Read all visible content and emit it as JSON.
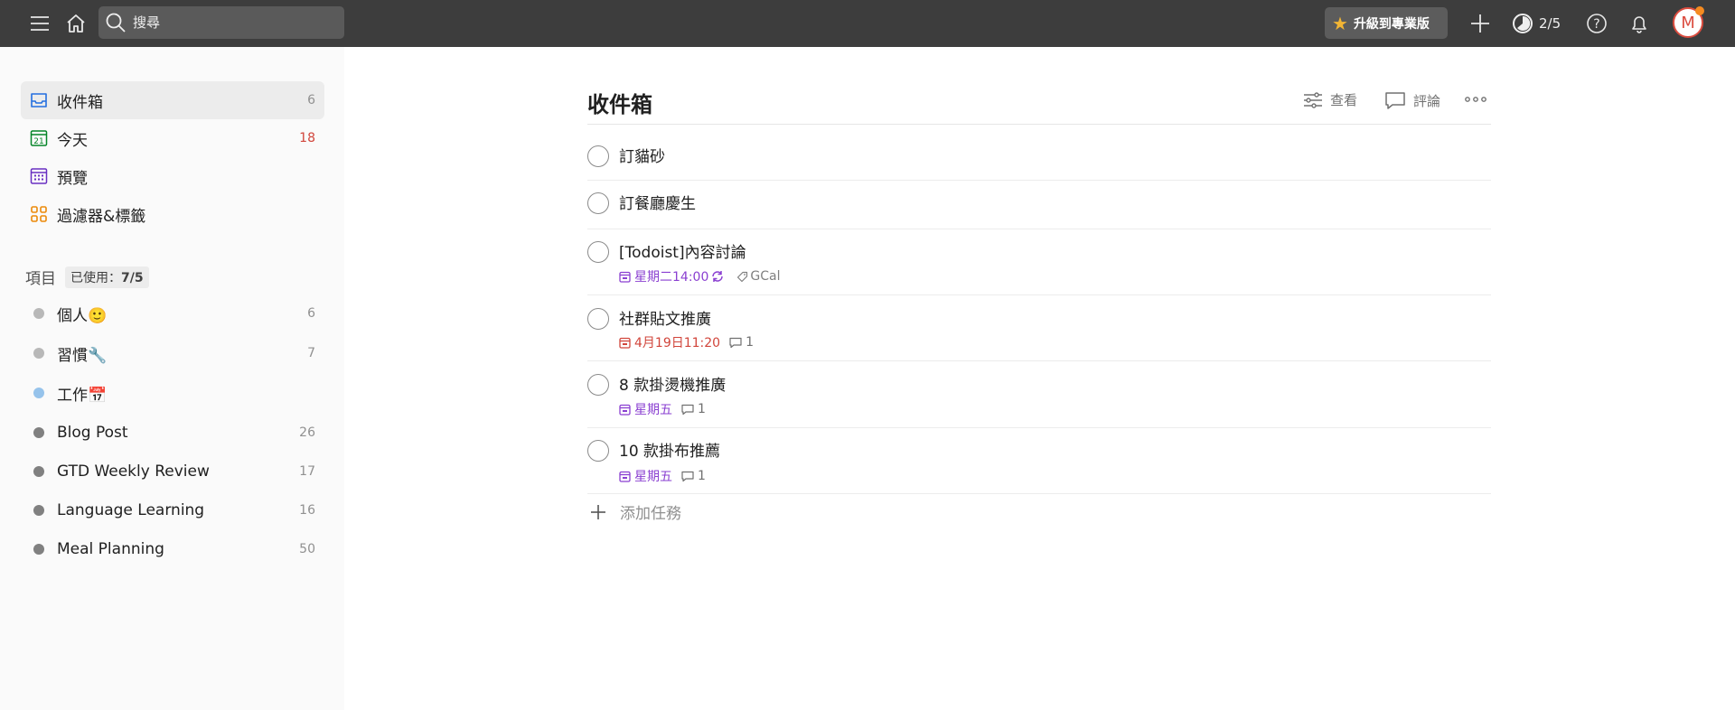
{
  "topbar": {
    "search_placeholder": "搜尋",
    "upgrade_label": "升級到專業版",
    "karma_text": "2/5",
    "avatar_letter": "M"
  },
  "sidebar": {
    "nav": [
      {
        "label": "收件箱",
        "count": "6"
      },
      {
        "label": "今天",
        "count": "18"
      },
      {
        "label": "預覽",
        "count": ""
      },
      {
        "label": "過濾器&標籤",
        "count": ""
      }
    ],
    "today_icon_day": "21",
    "projects_header": {
      "label": "項目",
      "usage_prefix": "已使用：",
      "usage_value": "7/5"
    },
    "projects": [
      {
        "label": "個人🙂",
        "count": "6",
        "color": "#b8b8b8"
      },
      {
        "label": "習慣🔧",
        "count": "7",
        "color": "#b8b8b8"
      },
      {
        "label": "工作📅",
        "count": "",
        "color": "#96c3eb"
      },
      {
        "label": "Blog Post",
        "count": "26",
        "color": "#808080"
      },
      {
        "label": "GTD Weekly Review",
        "count": "17",
        "color": "#808080"
      },
      {
        "label": "Language Learning",
        "count": "16",
        "color": "#808080"
      },
      {
        "label": "Meal Planning",
        "count": "50",
        "color": "#808080"
      }
    ]
  },
  "main": {
    "title": "收件箱",
    "view_label": "查看",
    "comment_label": "評論",
    "tasks": [
      {
        "title": "訂貓砂"
      },
      {
        "title": "訂餐廳慶生"
      },
      {
        "title": "[Todoist]內容討論",
        "date": "星期二14:00",
        "label": "GCal"
      },
      {
        "title": "社群貼文推廣",
        "date": "4月19日11:20",
        "comments": "1"
      },
      {
        "title": "8 款掛燙機推廣",
        "date": "星期五",
        "comments": "1"
      },
      {
        "title": "10 款掛布推薦",
        "date": "星期五",
        "comments": "1"
      }
    ],
    "add_task_label": "添加任務"
  },
  "colors": {
    "topbar": "#3d3d3d",
    "accent_red": "#db4c3f",
    "date_purple": "#8a3fd1",
    "overdue_red": "#d1453b",
    "star": "#f2b534"
  }
}
